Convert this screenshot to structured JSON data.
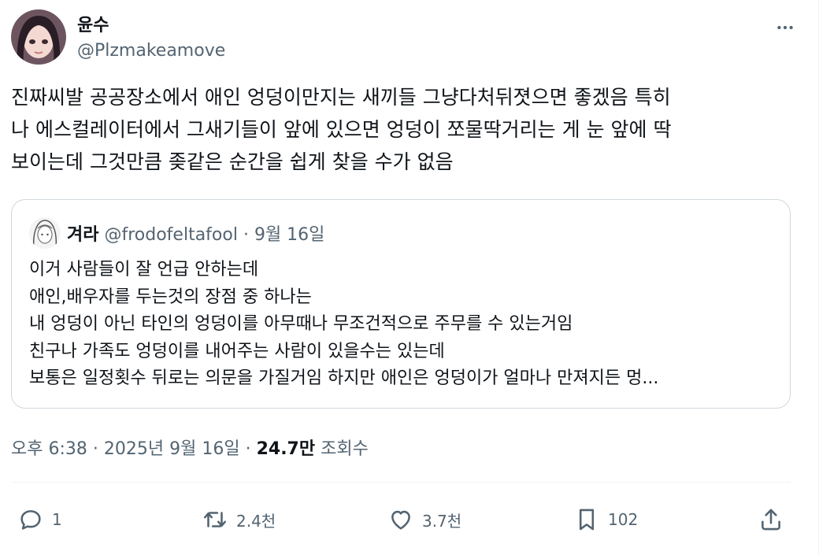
{
  "author": {
    "name": "윤수",
    "handle": "@Plzmakeamove"
  },
  "tweet": {
    "text": "진짜씨발 공공장소에서 애인 엉덩이만지는 새끼들 그냥다처뒤졋으면 좋겠음 특히\n나 에스컬레이터에서 그새기들이 앞에 있으면 엉덩이 쪼물딱거리는 게 눈 앞에 딱\n보이는데 그것만큼 좆같은 순간을 쉽게 찾을 수가 없음"
  },
  "quote": {
    "name": "겨라",
    "handle": "@frodofeltafool",
    "separator": "·",
    "date": "9월 16일",
    "text": "이거 사람들이 잘 언급 안하는데\n애인,배우자를 두는것의 장점 중 하나는\n내 엉덩이 아닌 타인의 엉덩이를 아무때나 무조건적으로 주무를 수 있는거임\n친구나 가족도 엉덩이를 내어주는 사람이 있을수는 있는데\n보통은 일정횟수 뒤로는 의문을 가질거임 하지만 애인은 엉덩이가 얼마나 만져지든 멍..."
  },
  "meta": {
    "time": "오후 6:38",
    "separator": "·",
    "date": "2025년 9월 16일",
    "views_count": "24.7만",
    "views_label": "조회수"
  },
  "actions": {
    "reply_count": "1",
    "retweet_count": "2.4천",
    "like_count": "3.7천",
    "bookmark_count": "102"
  },
  "icons": {
    "more": "more-icon",
    "reply": "reply-icon",
    "retweet": "retweet-icon",
    "like": "heart-icon",
    "bookmark": "bookmark-icon",
    "share": "share-icon"
  },
  "colors": {
    "text": "#0f1419",
    "secondary": "#536471",
    "border": "#cfd9de"
  }
}
